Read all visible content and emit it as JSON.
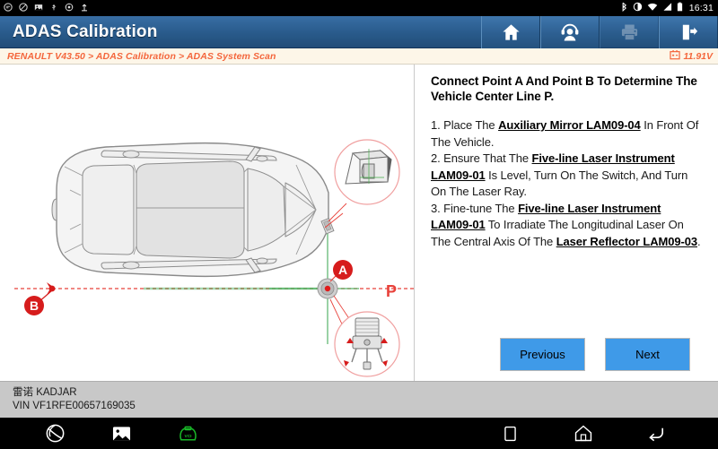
{
  "statusbar": {
    "left_icons": [
      "message-icon",
      "mute-icon",
      "screenshot-icon",
      "usb-icon",
      "settings-icon",
      "upload-icon"
    ],
    "right_icons": [
      "bluetooth-icon",
      "brightness-icon",
      "wifi-icon",
      "signal-icon",
      "battery-icon"
    ],
    "clock": "16:31"
  },
  "header": {
    "title": "ADAS Calibration",
    "buttons": [
      {
        "name": "home-button",
        "icon": "home-icon",
        "enabled": true
      },
      {
        "name": "support-button",
        "icon": "headset-icon",
        "enabled": true
      },
      {
        "name": "print-button",
        "icon": "printer-icon",
        "enabled": false
      },
      {
        "name": "exit-button",
        "icon": "exit-icon",
        "enabled": true
      }
    ]
  },
  "breadcrumb": {
    "path": "RENAULT V43.50 > ADAS Calibration > ADAS System Scan",
    "battery_icon": "battery-voltage-icon",
    "voltage": "11.91V"
  },
  "diagram": {
    "name": "vehicle-top-view-diagram",
    "point_a_label": "A",
    "point_b_label": "B",
    "center_line_label": "P",
    "callout_top": "auxiliary-mirror-callout",
    "callout_bottom": "laser-instrument-callout",
    "center_line_color": "#e8413a",
    "marker_color": "#d61c1c"
  },
  "instructions": {
    "title": "Connect Point A And Point B To Determine The Vehicle Center Line P.",
    "steps": [
      {
        "num": "1. ",
        "pre": "Place The ",
        "bold": "Auxiliary Mirror LAM09-04",
        "post": " In Front Of The Vehicle."
      },
      {
        "num": "2. ",
        "pre": "Ensure That The ",
        "bold": "Five-line Laser Instrument LAM09-01",
        "post": " Is Level, Turn On The Switch, And Turn On The Laser Ray."
      },
      {
        "num": "3. ",
        "pre": "Fine-tune The ",
        "bold": "Five-line Laser Instrument LAM09-01",
        "mid": " To Irradiate The Longitudinal Laser On The Central Axis Of The ",
        "bold2": "Laser Reflector LAM09-03",
        "post": "."
      }
    ]
  },
  "actions": {
    "previous_label": "Previous",
    "next_label": "Next",
    "button_color": "#3f9ae8"
  },
  "vehicle_info": {
    "model": "雷诺 KADJAR",
    "vin": "VIN VF1RFE00657169035"
  },
  "navbar": {
    "left_icons": [
      "browser-icon",
      "gallery-icon",
      "vci-icon"
    ],
    "right_icons": [
      "recents-icon",
      "home-icon",
      "back-icon"
    ],
    "vci_color": "#19b828"
  }
}
